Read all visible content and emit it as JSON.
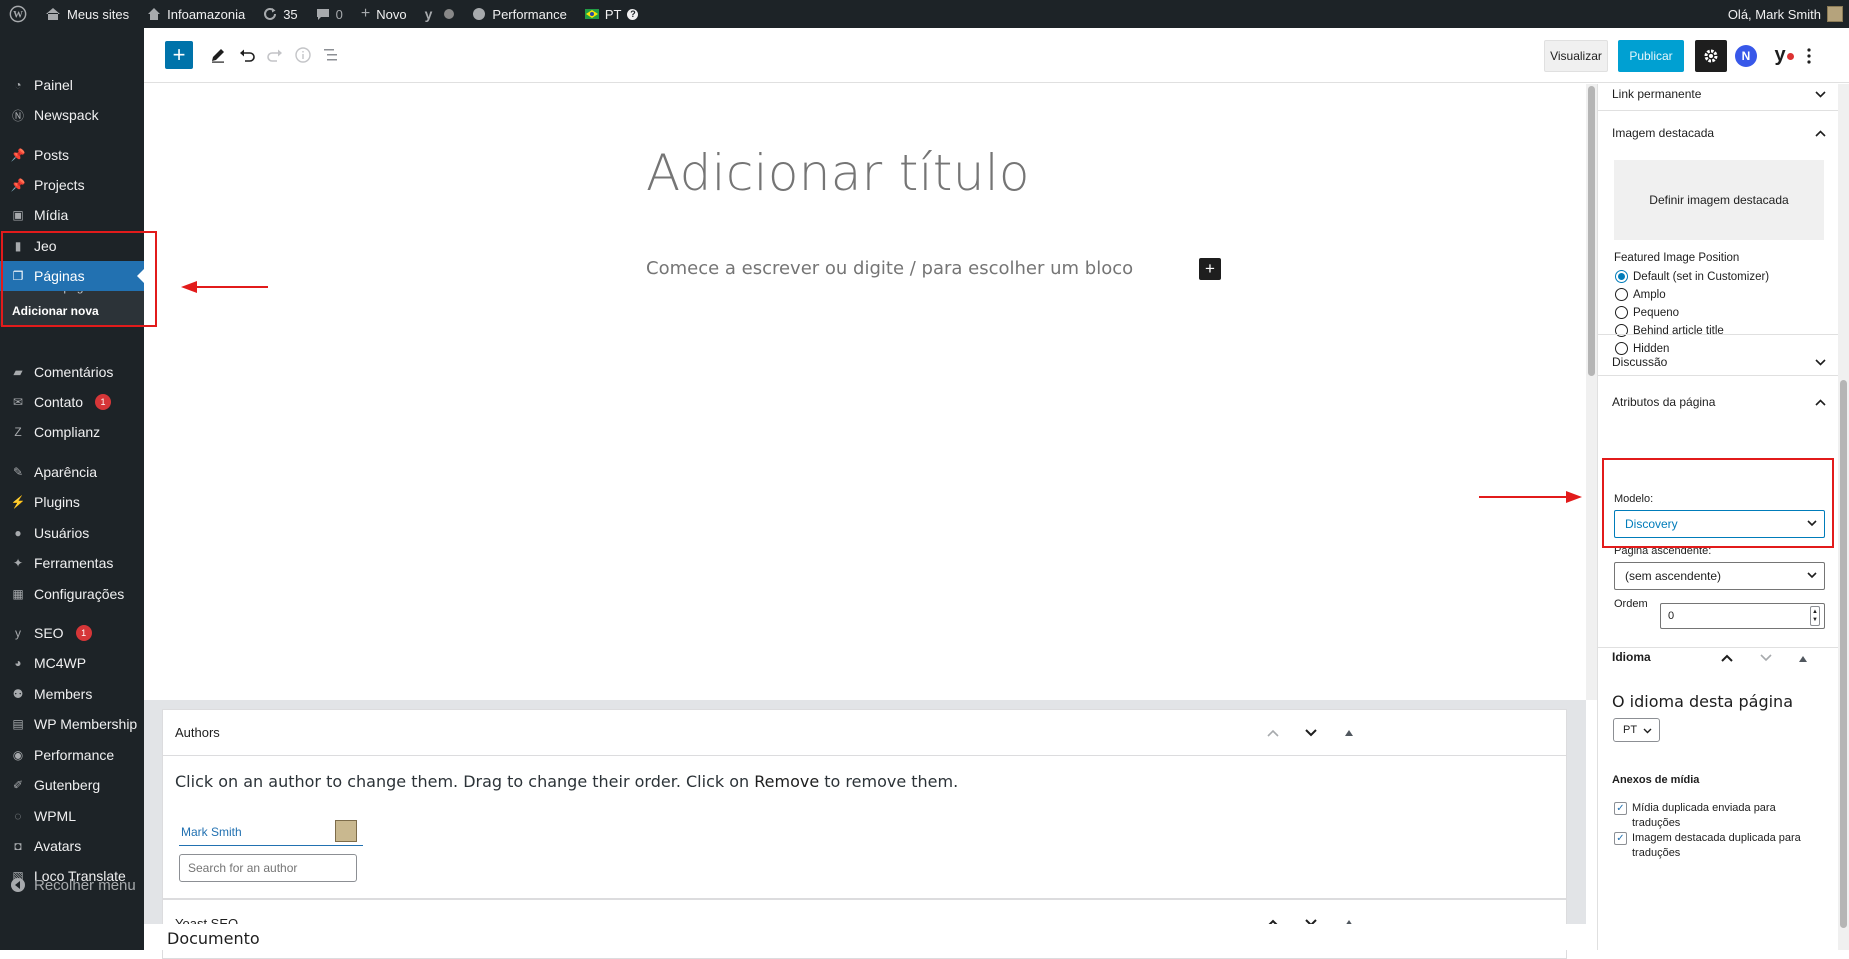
{
  "adminbar": {
    "my_sites": "Meus sites",
    "site_name": "Infoamazonia",
    "updates_count": "35",
    "comments_count": "0",
    "new_label": "Novo",
    "performance": "Performance",
    "language": "PT",
    "greeting": "Olá, Mark Smith"
  },
  "sidebar": {
    "items": [
      {
        "label": "Painel",
        "icon": "dashboard-icon"
      },
      {
        "label": "Newspack",
        "icon": "newspack-icon"
      },
      {
        "label": "Posts",
        "icon": "pin-icon"
      },
      {
        "label": "Projects",
        "icon": "pin-icon"
      },
      {
        "label": "Mídia",
        "icon": "media-icon"
      },
      {
        "label": "Jeo",
        "icon": "jeo-icon"
      },
      {
        "label": "Páginas",
        "icon": "pages-icon"
      },
      {
        "label": "Comentários",
        "icon": "comment-icon"
      },
      {
        "label": "Contato",
        "icon": "mail-icon",
        "badge": "1"
      },
      {
        "label": "Complianz",
        "icon": "complianz-icon"
      },
      {
        "label": "Aparência",
        "icon": "brush-icon"
      },
      {
        "label": "Plugins",
        "icon": "plugin-icon"
      },
      {
        "label": "Usuários",
        "icon": "user-icon"
      },
      {
        "label": "Ferramentas",
        "icon": "wrench-icon"
      },
      {
        "label": "Configurações",
        "icon": "settings-icon"
      },
      {
        "label": "SEO",
        "icon": "yoast-icon",
        "badge": "1"
      },
      {
        "label": "MC4WP",
        "icon": "mc4wp-icon"
      },
      {
        "label": "Members",
        "icon": "members-icon"
      },
      {
        "label": "WP Membership",
        "icon": "membership-icon"
      },
      {
        "label": "Performance",
        "icon": "performance-icon"
      },
      {
        "label": "Gutenberg",
        "icon": "gutenberg-icon"
      },
      {
        "label": "WPML",
        "icon": "wpml-icon"
      },
      {
        "label": "Avatars",
        "icon": "avatars-icon"
      },
      {
        "label": "Loco Translate",
        "icon": "loco-icon"
      }
    ],
    "submenu": {
      "all_pages": "Todas as páginas",
      "add_new": "Adicionar nova"
    },
    "collapse": "Recolher menu"
  },
  "toolbar": {
    "preview": "Visualizar",
    "publish": "Publicar"
  },
  "editor": {
    "title_placeholder": "Adicionar título",
    "paragraph_placeholder": "Comece a escrever ou digite / para escolher um bloco"
  },
  "metaboxes": {
    "authors": {
      "title": "Authors",
      "help_prefix": "Click on an author to change them. Drag to change their order. Click on ",
      "help_bold": "Remove",
      "help_suffix": " to remove them.",
      "author_name": "Mark Smith",
      "search_placeholder": "Search for an author"
    },
    "yoast": {
      "title": "Yoast SEO"
    }
  },
  "footer": {
    "breadcrumb": "Documento"
  },
  "settings": {
    "permalink": "Link permanente",
    "featured_image": "Imagem destacada",
    "set_featured": "Definir imagem destacada",
    "featured_position_label": "Featured Image Position",
    "featured_position_options": [
      "Default (set in Customizer)",
      "Amplo",
      "Pequeno",
      "Behind article title",
      "Hidden"
    ],
    "featured_position_selected": "Default (set in Customizer)",
    "discussion": "Discussão",
    "page_attributes": "Atributos da página",
    "template_label": "Modelo:",
    "template_value": "Discovery",
    "parent_label": "Página ascendente:",
    "parent_value": "(sem ascendente)",
    "order_label": "Ordem",
    "order_value": "0",
    "language_panel": "Idioma",
    "language_title": "O idioma desta página",
    "language_value": "PT",
    "media_attachments": "Anexos de mídia",
    "dup_media": "Mídia duplicada enviada para traduções",
    "dup_featured": "Imagem destacada duplicada para traduções"
  },
  "colors": {
    "accent": "#2271b1",
    "annotation": "#e21b1b",
    "publish": "#00a0d2"
  }
}
